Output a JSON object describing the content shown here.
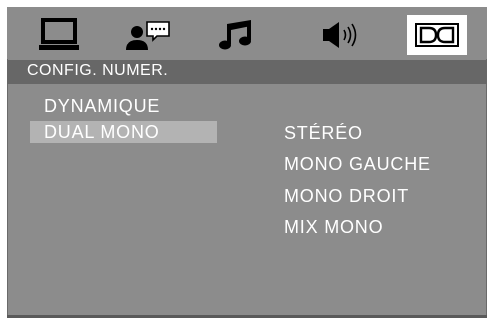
{
  "header": {
    "title": "CONFIG. NUMER."
  },
  "tabs": [
    {
      "icon": "monitor-icon"
    },
    {
      "icon": "speaker-person-icon"
    },
    {
      "icon": "music-note-icon"
    },
    {
      "icon": "speaker-volume-icon"
    },
    {
      "icon": "dolby-icon",
      "selected": true
    }
  ],
  "menu": {
    "items": [
      {
        "label": "DYNAMIQUE"
      },
      {
        "label": "DUAL MONO",
        "highlighted": true
      }
    ]
  },
  "options": {
    "items": [
      {
        "label": "STÉRÉO"
      },
      {
        "label": "MONO GAUCHE"
      },
      {
        "label": "MONO DROIT"
      },
      {
        "label": "MIX MONO"
      }
    ]
  },
  "colors": {
    "panel": "#8c8c8c",
    "header": "#676767",
    "highlight": "#b3b3b3",
    "text": "#ffffff"
  }
}
